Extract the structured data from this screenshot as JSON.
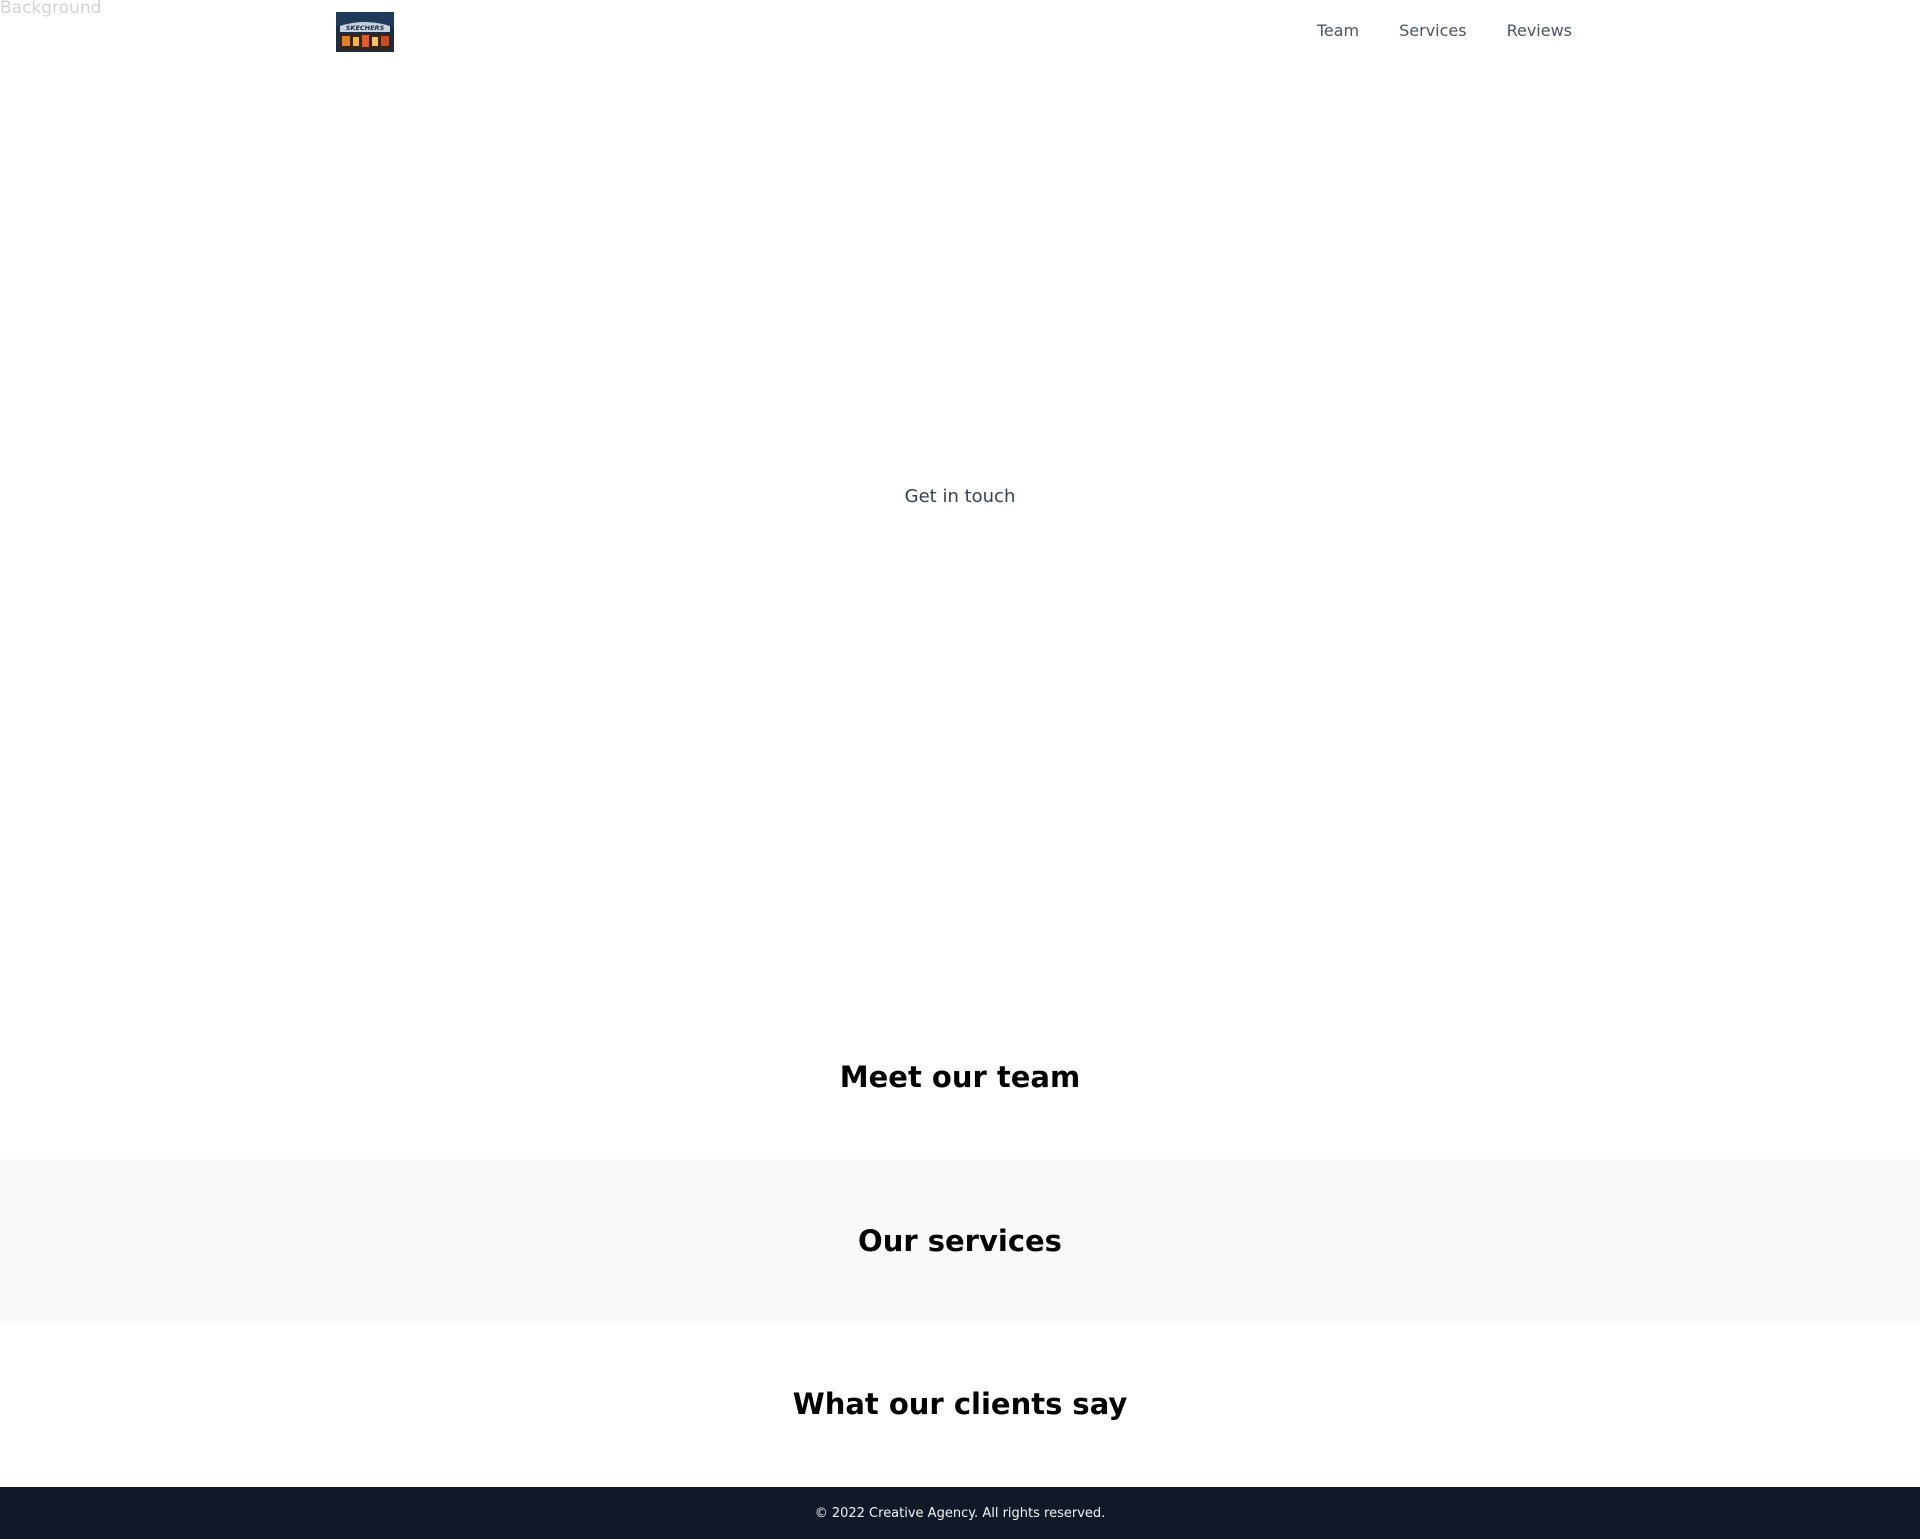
{
  "background": {
    "alt_text": "Background"
  },
  "header": {
    "logo_text": "SKECHERS",
    "nav": [
      {
        "label": "Team"
      },
      {
        "label": "Services"
      },
      {
        "label": "Reviews"
      }
    ]
  },
  "hero": {
    "cta_label": "Get in touch"
  },
  "sections": {
    "team_title": "Meet our team",
    "services_title": "Our services",
    "reviews_title": "What our clients say"
  },
  "footer": {
    "copyright": "© 2022 Creative Agency. All rights reserved."
  },
  "colors": {
    "footer_bg": "#111827",
    "services_bg": "#f9fafb",
    "nav_text": "#4b5563"
  }
}
